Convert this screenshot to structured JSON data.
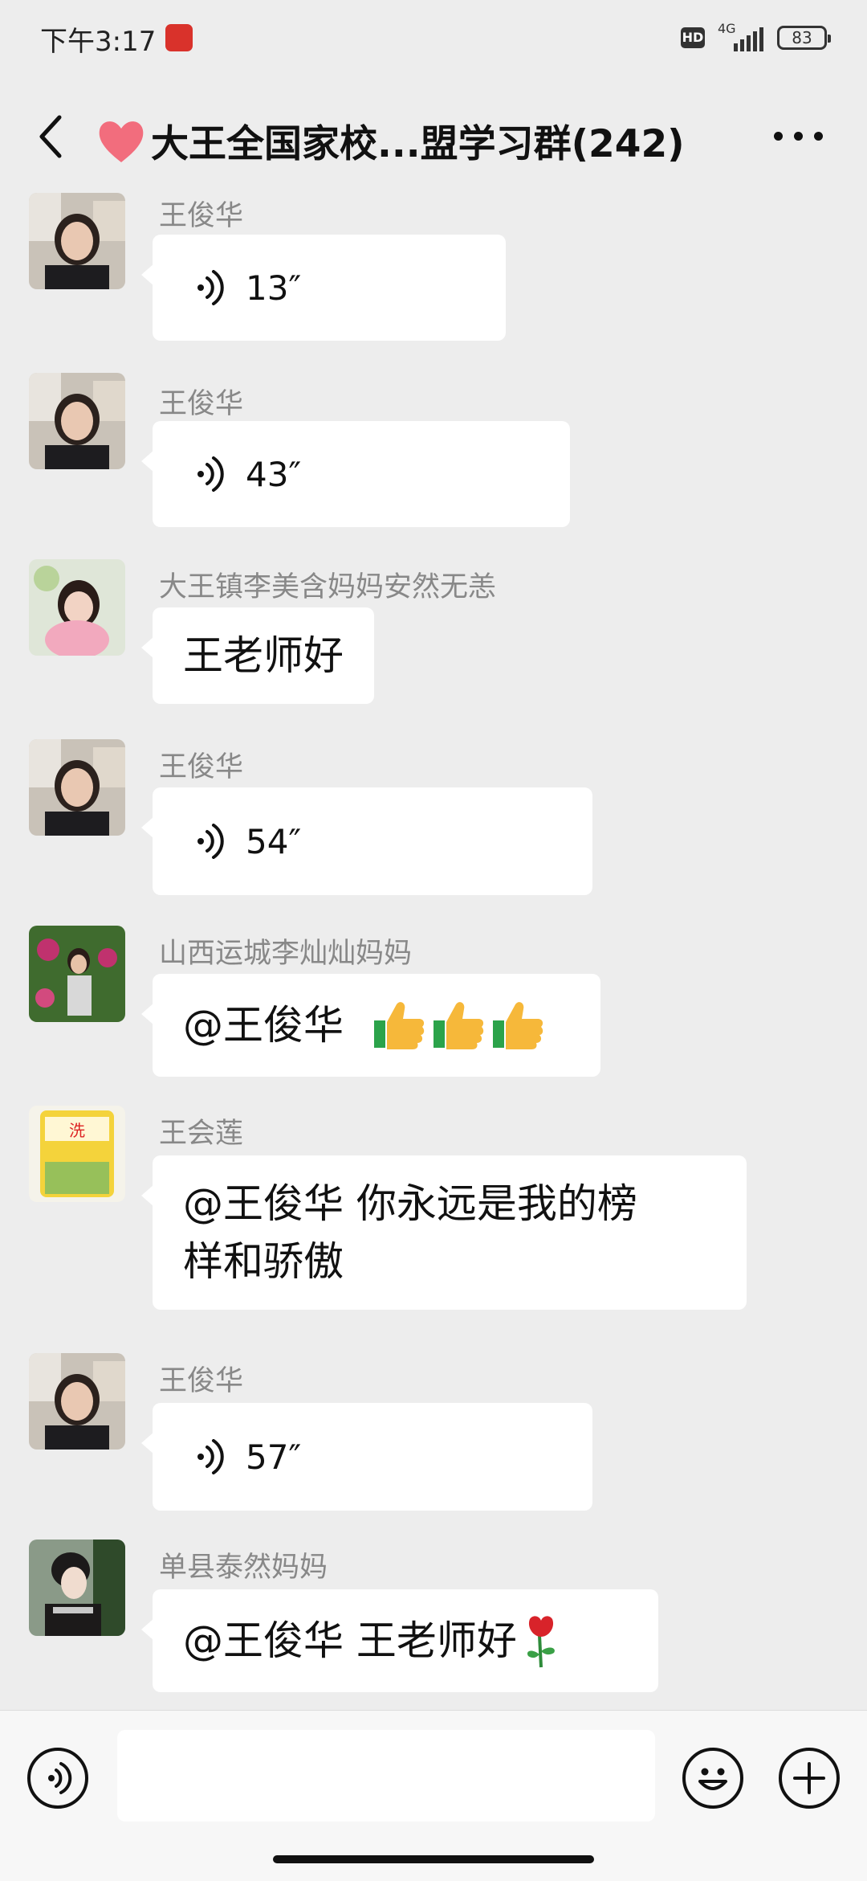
{
  "status": {
    "time": "下午3:17",
    "hd": "HD",
    "network": "4G",
    "battery": "83"
  },
  "header": {
    "title": "大王全国家校...盟学习群(242)"
  },
  "messages": [
    {
      "sender": "王俊华",
      "type": "voice",
      "duration": "13″"
    },
    {
      "sender": "王俊华",
      "type": "voice",
      "duration": "43″"
    },
    {
      "sender": "大王镇李美含妈妈安然无恙",
      "type": "text",
      "text": "王老师好"
    },
    {
      "sender": "王俊华",
      "type": "voice",
      "duration": "54″"
    },
    {
      "sender": "山西运城李灿灿妈妈",
      "type": "text",
      "text": "@王俊华 "
    },
    {
      "sender": "王会莲",
      "type": "text",
      "text_line1": "@王俊华  你永远是我的榜",
      "text_line2": "样和骄傲"
    },
    {
      "sender": "王俊华",
      "type": "voice",
      "duration": "57″"
    },
    {
      "sender": "单县泰然妈妈",
      "type": "text",
      "text": "@王俊华  王老师好"
    }
  ],
  "icons": {
    "back": "chevron-left-icon",
    "more": "more-dots-icon",
    "voice": "voice-wave-icon",
    "thumbs": "thumbs-up-icon",
    "rose": "rose-icon",
    "emoji": "emoji-icon",
    "plus": "plus-icon"
  },
  "colors": {
    "background": "#ededed",
    "bubble": "#ffffff",
    "sender": "#888888"
  }
}
